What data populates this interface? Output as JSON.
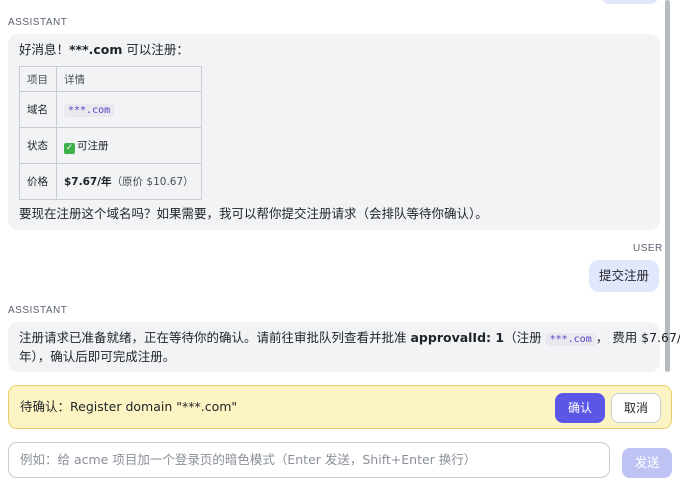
{
  "chat": {
    "messages": [
      {
        "role": "ASSISTANT",
        "intro_domain": "***.com",
        "intro_suffix": " 可以注册：",
        "intro_prefix": "好消息！",
        "table": {
          "headers": [
            "项目",
            "详情"
          ],
          "rows": [
            {
              "label": "域名",
              "value": "***.com"
            },
            {
              "label": "状态",
              "value": "可注册"
            },
            {
              "label": "价格",
              "value_bold": "$7.67/年",
              "value_note": "（原价 $10.67）"
            }
          ]
        },
        "outro": "要现在注册这个域名吗？如果需要，我可以帮你提交注册请求（会排队等待你确认）。"
      },
      {
        "role": "USER",
        "text": "提交注册"
      },
      {
        "role": "ASSISTANT",
        "line1_a": "注册请求已准备就绪，正在等待你的确认。请前往审批队列查看并批准 ",
        "line1_bold": "approvalId: 1",
        "line1_b": "（注册 ",
        "line1_code": "***.com",
        "line1_c": "， 费用 $7.67/",
        "line2": "年），确认后即可完成注册。"
      }
    ]
  },
  "confirm_bar": {
    "label": "待确认：Register domain \"***.com\"",
    "confirm_label": "确认",
    "cancel_label": "取消"
  },
  "composer": {
    "placeholder": "例如：给 acme 项目加一个登录页的暗色模式（Enter 发送，Shift+Enter 换行）",
    "send_label": "发送"
  },
  "colors": {
    "accent": "#5b57e6",
    "confirm_bg": "#fdf4c4",
    "user_bubble": "#e2e7fb",
    "assistant_bubble": "#f1f3f5"
  }
}
